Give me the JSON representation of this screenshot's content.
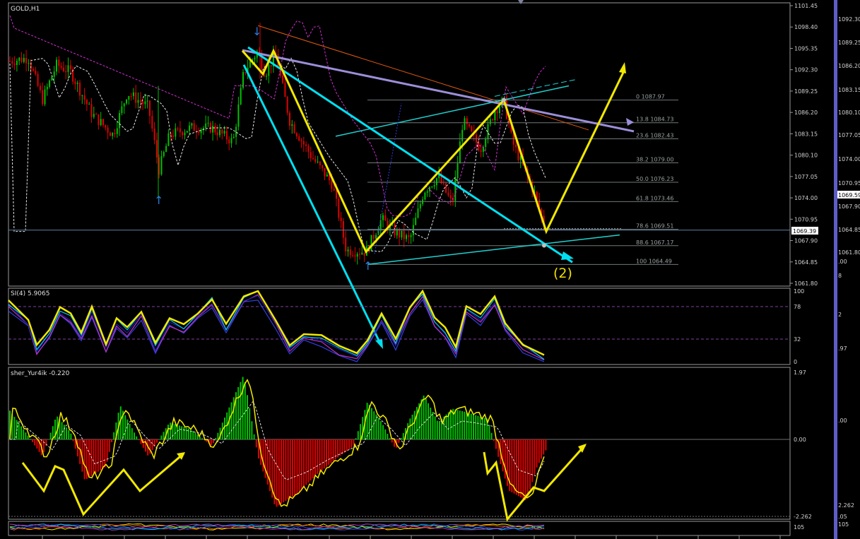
{
  "main": {
    "symbol_label": "GOLD,H1",
    "price_axis": [
      "1101.45",
      "1098.40",
      "1095.35",
      "1092.30",
      "1089.25",
      "1086.20",
      "1083.15",
      "1080.10",
      "1077.05",
      "1074.00",
      "1070.95",
      "1067.90",
      "1064.85",
      "1061.80"
    ],
    "current_price": "1069.39",
    "fib_labels": [
      "0 1087.97",
      "13.8 1084.73",
      "23.6 1082.43",
      "38.2 1079.00",
      "50.0 1076.23",
      "61.8 1073.46",
      "78.6 1069.51",
      "88.6 1067.17",
      "100 1064.49"
    ],
    "wave_label": "(2)"
  },
  "right_axis": {
    "labels": [
      "1092.30",
      "1089.25",
      "1086.20",
      "1083.15",
      "1080.10",
      "1077.05",
      "1074.00",
      "1070.95",
      "1067.90",
      "1064.85",
      "1061.80",
      ".00",
      "8",
      "2",
      ".97",
      ".00",
      "2.262",
      ".05",
      "105"
    ],
    "current_price": "1069.59"
  },
  "rsi": {
    "label": "SI(4) 5.9065",
    "levels": [
      "100",
      "78",
      "32",
      "0"
    ]
  },
  "fisher": {
    "label": "sher_Yur4ik -0.220",
    "levels": [
      "1.97",
      "0.00",
      "-2.262"
    ]
  },
  "bottom_strip": {
    "level": "105"
  },
  "colors": {
    "yellow": "#f2e800",
    "cyan": "#00e0f0",
    "lavender": "#9c8ed8",
    "orange": "#e05a10",
    "green": "#00c000",
    "red": "#e00000",
    "magenta": "#d030d0",
    "axis_blue": "#6a6ad8"
  },
  "chart_data": [
    {
      "type": "line",
      "title": "GOLD,H1",
      "ylim": [
        1061.8,
        1101.45
      ],
      "current_price": 1069.39,
      "fibonacci_levels": [
        {
          "ratio": 0,
          "price": 1087.97
        },
        {
          "ratio": 13.8,
          "price": 1084.73
        },
        {
          "ratio": 23.6,
          "price": 1082.43
        },
        {
          "ratio": 38.2,
          "price": 1079.0
        },
        {
          "ratio": 50.0,
          "price": 1076.23
        },
        {
          "ratio": 61.8,
          "price": 1073.46
        },
        {
          "ratio": 78.6,
          "price": 1069.51
        },
        {
          "ratio": 88.6,
          "price": 1067.17
        },
        {
          "ratio": 100,
          "price": 1064.49
        }
      ],
      "wave_pattern_prices": [
        1095.0,
        1091.7,
        1095.0,
        1066.3,
        1087.97,
        1069.2,
        1091.9
      ],
      "annotation": "(2)"
    },
    {
      "type": "line",
      "title": "SI(4) 5.9065",
      "ylim": [
        0,
        100
      ],
      "levels": [
        100,
        78,
        32,
        0
      ],
      "current_value": 5.9065
    },
    {
      "type": "bar",
      "title": "sher_Yur4ik -0.220",
      "ylim": [
        -2.262,
        1.97
      ],
      "levels": [
        1.97,
        0.0,
        -2.262
      ],
      "current_value": -0.22
    }
  ]
}
